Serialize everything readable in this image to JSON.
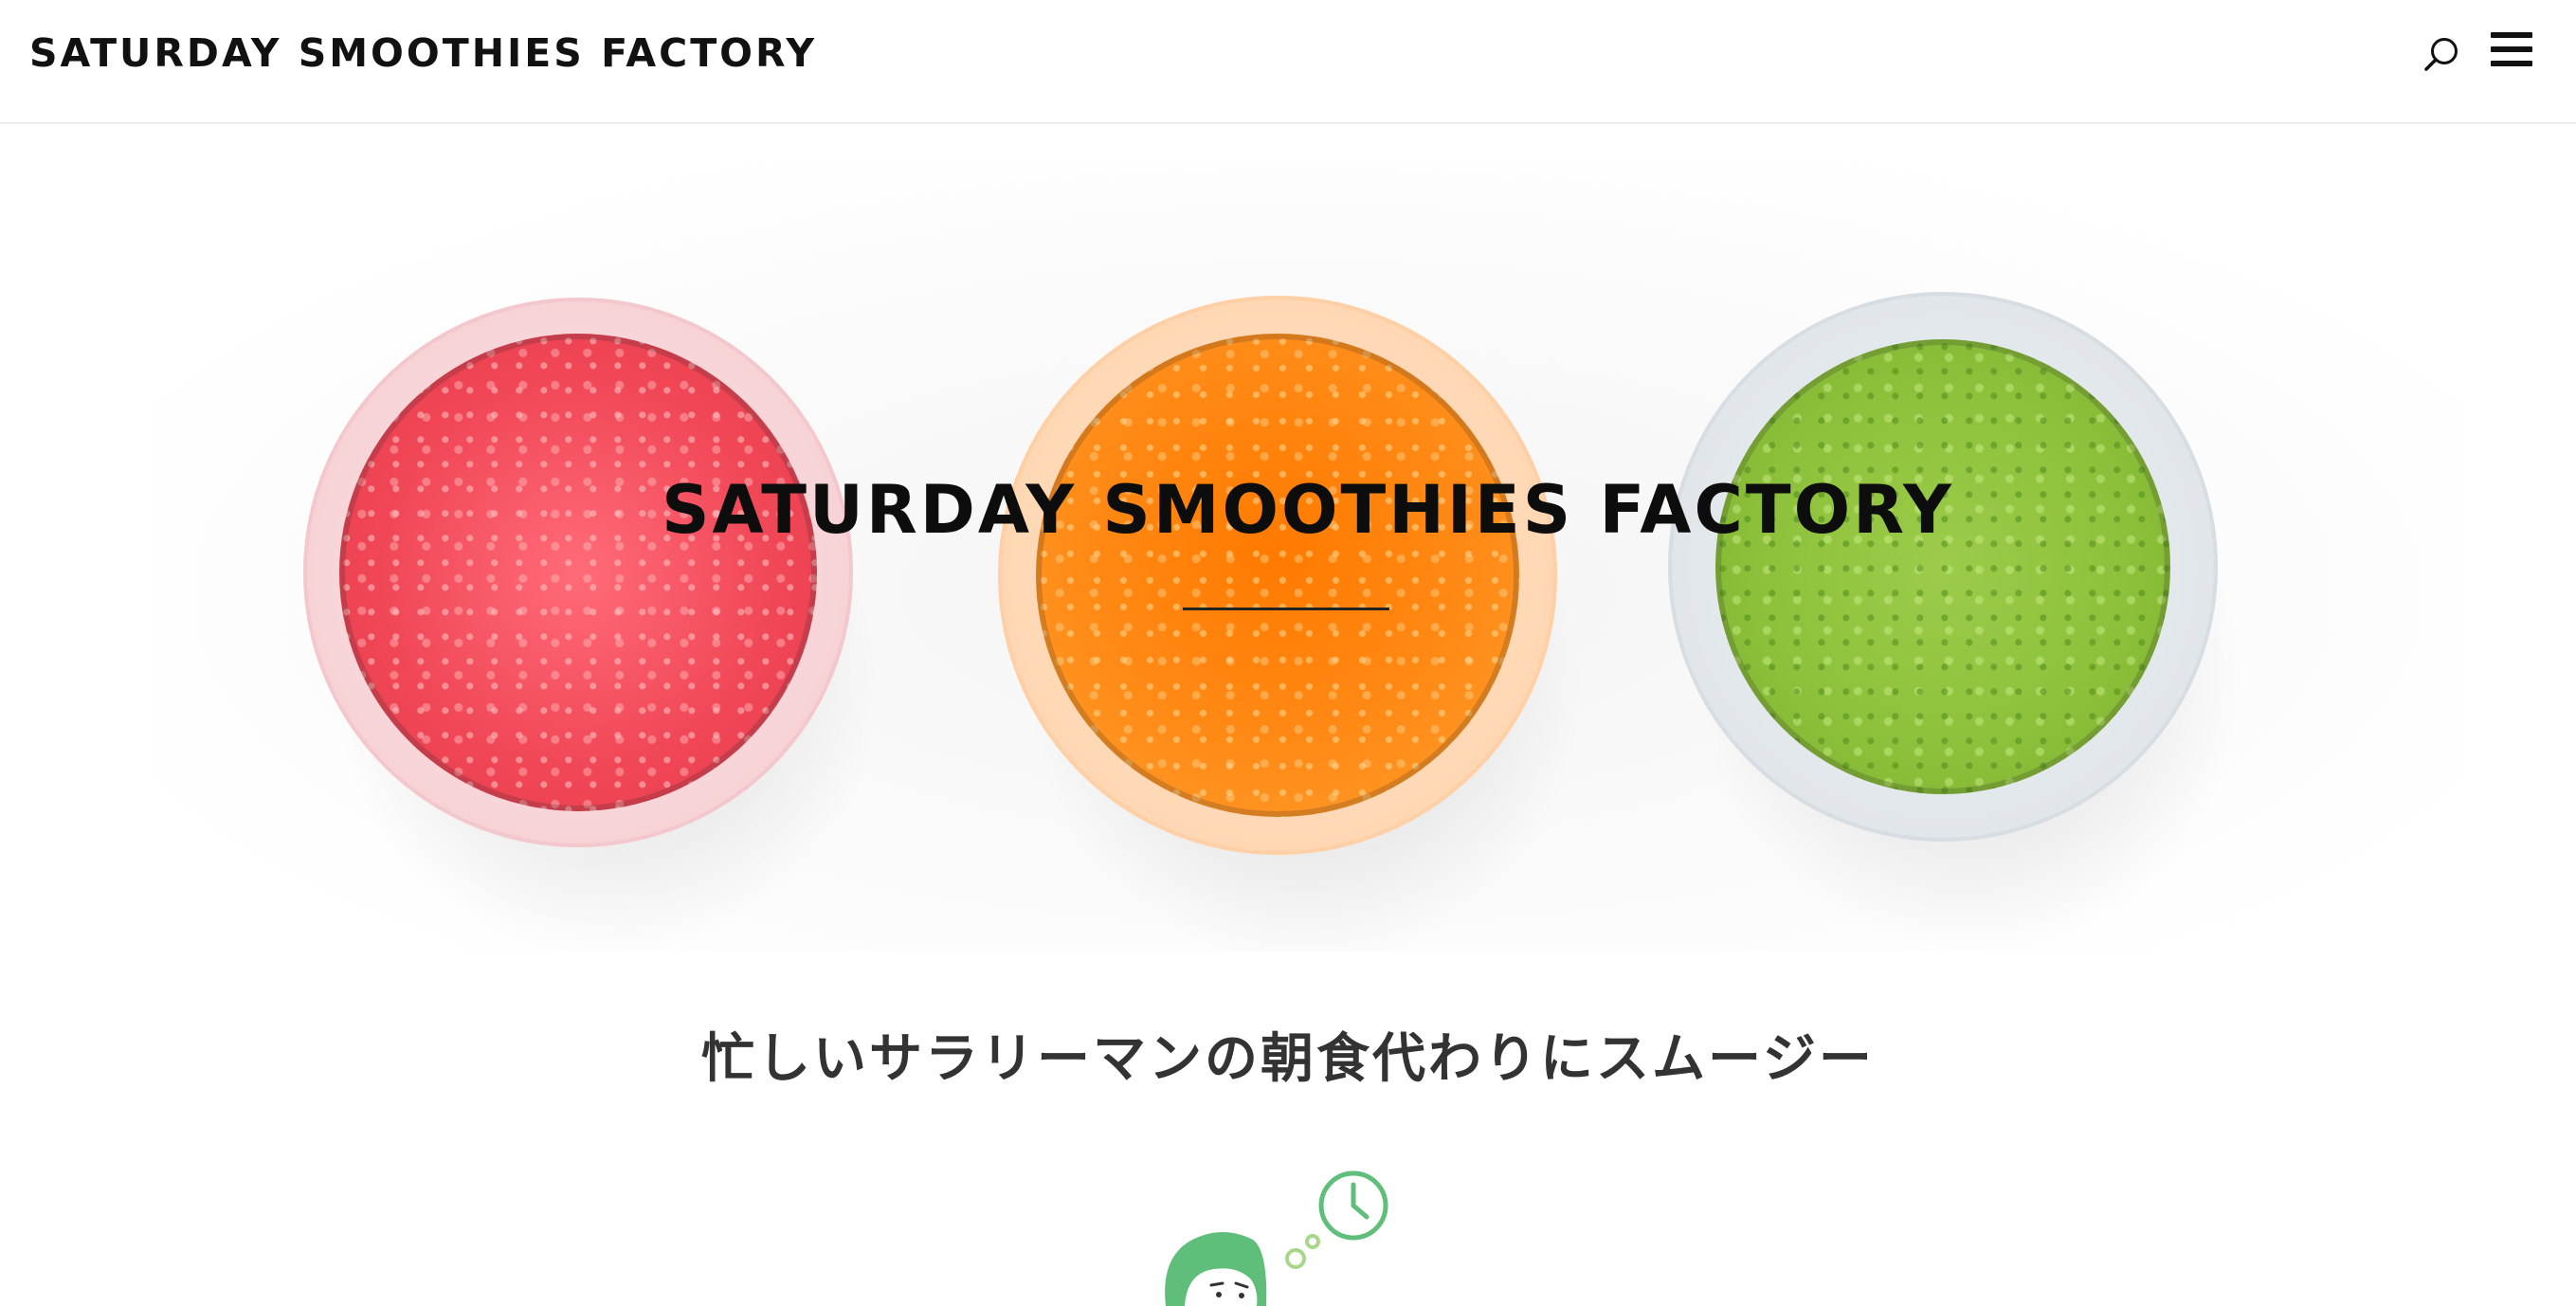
{
  "header": {
    "logo_text": "SATURDAY SMOOTHIES FACTORY",
    "icons": [
      "search-icon",
      "menu-icon"
    ]
  },
  "hero": {
    "title": "SATURDAY SMOOTHIES FACTORY",
    "glasses": [
      {
        "name": "red-smoothie",
        "color": "#ef4a5a"
      },
      {
        "name": "orange-smoothie",
        "color": "#ff7f12"
      },
      {
        "name": "green-smoothie",
        "color": "#8fc23a"
      }
    ]
  },
  "section": {
    "heading": "忙しいサラリーマンの朝食代わりにスムージー"
  },
  "colors": {
    "text": "#111111",
    "accent_green": "#5fbf7a",
    "divider": "#222222"
  }
}
